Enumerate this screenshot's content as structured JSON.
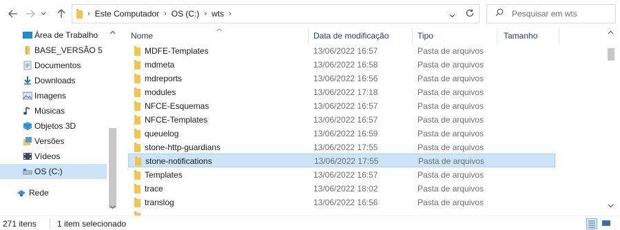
{
  "address": {
    "crumbs": [
      "Este Computador",
      "OS (C:)",
      "wts"
    ],
    "search_placeholder": "Pesquisar em wts"
  },
  "nav": {
    "items": [
      {
        "label": "Área de Trabalho",
        "icon": "desktop-icon"
      },
      {
        "label": "BASE_VERSÃO 5",
        "icon": "folder-icon"
      },
      {
        "label": "Documentos",
        "icon": "documents-icon"
      },
      {
        "label": "Downloads",
        "icon": "download-icon"
      },
      {
        "label": "Imagens",
        "icon": "pictures-icon"
      },
      {
        "label": "Músicas",
        "icon": "music-icon"
      },
      {
        "label": "Objetos 3D",
        "icon": "objects3d-icon"
      },
      {
        "label": "Versões",
        "icon": "versions-icon"
      },
      {
        "label": "Vídeos",
        "icon": "videos-icon"
      },
      {
        "label": "OS (C:)",
        "icon": "drive-icon"
      },
      {
        "label": "Rede",
        "icon": "network-icon"
      }
    ],
    "selected": "OS (C:)"
  },
  "columns": {
    "name": "Nome",
    "date": "Data de modificação",
    "type": "Tipo",
    "size": "Tamanho"
  },
  "files": [
    {
      "name": "MDFE-Templates",
      "date": "13/06/2022 16:57",
      "type": "Pasta de arquivos"
    },
    {
      "name": "mdmeta",
      "date": "13/06/2022 16:58",
      "type": "Pasta de arquivos"
    },
    {
      "name": "mdreports",
      "date": "13/06/2022 16:56",
      "type": "Pasta de arquivos"
    },
    {
      "name": "modules",
      "date": "13/06/2022 17:18",
      "type": "Pasta de arquivos"
    },
    {
      "name": "NFCE-Esquemas",
      "date": "13/06/2022 16:57",
      "type": "Pasta de arquivos"
    },
    {
      "name": "NFCE-Templates",
      "date": "13/06/2022 16:57",
      "type": "Pasta de arquivos"
    },
    {
      "name": "queuelog",
      "date": "13/06/2022 16:59",
      "type": "Pasta de arquivos"
    },
    {
      "name": "stone-http-guardians",
      "date": "13/06/2022 17:55",
      "type": "Pasta de arquivos"
    },
    {
      "name": "stone-notifications",
      "date": "13/06/2022 17:55",
      "type": "Pasta de arquivos"
    },
    {
      "name": "Templates",
      "date": "13/06/2022 16:57",
      "type": "Pasta de arquivos"
    },
    {
      "name": "trace",
      "date": "13/06/2022 18:02",
      "type": "Pasta de arquivos"
    },
    {
      "name": "translog",
      "date": "13/06/2022 16:56",
      "type": "Pasta de arquivos"
    }
  ],
  "selected_file": "stone-notifications",
  "status": {
    "count": "271 itens",
    "selection": "1 item selecionado"
  },
  "colors": {
    "selection_bg": "#cce4f7",
    "selection_border": "#99d1ff",
    "folder": "#f4c84f"
  }
}
